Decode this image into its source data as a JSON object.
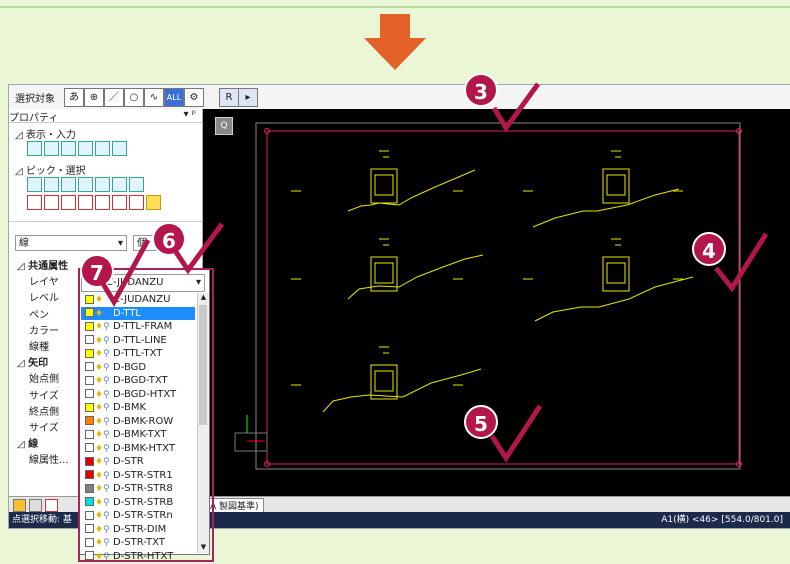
{
  "toolbar": {
    "select_label": "選択対象",
    "buttons": [
      "あ",
      "⊕",
      "／",
      "○",
      "∿",
      "ALL",
      "⚙"
    ],
    "r_button": "R",
    "arrow_button": "▸"
  },
  "panel": {
    "title": "プロパティ",
    "section_display": "表示・入力",
    "section_pick": "ピック・選択",
    "dropdown_line": "線",
    "dropdown_right": "個",
    "props": [
      {
        "label": "共通属性",
        "bold": true
      },
      {
        "label": "レイヤ",
        "bold": false
      },
      {
        "label": "レベル",
        "bold": false
      },
      {
        "label": "ペン",
        "bold": false
      },
      {
        "label": "カラー",
        "bold": false
      },
      {
        "label": "線種",
        "bold": false
      },
      {
        "label": "矢印",
        "bold": true
      },
      {
        "label": "始点側",
        "bold": false
      },
      {
        "label": "サイズ",
        "bold": false
      },
      {
        "label": "終点側",
        "bold": false
      },
      {
        "label": "サイズ",
        "bold": false
      },
      {
        "label": "線",
        "bold": true
      },
      {
        "label": "線属性...",
        "bold": false
      }
    ]
  },
  "layer_dropdown": {
    "current": "C-JUDANZU",
    "items": [
      {
        "name": "C-JUDANZU",
        "color": "#ffff00",
        "selected": false,
        "mag": false
      },
      {
        "name": "D-TTL",
        "color": "#ffff00",
        "selected": true,
        "mag": false
      },
      {
        "name": "D-TTL-FRAM",
        "color": "#ffff00",
        "selected": false,
        "mag": true
      },
      {
        "name": "D-TTL-LINE",
        "color": "#ffffff",
        "selected": false,
        "mag": true
      },
      {
        "name": "D-TTL-TXT",
        "color": "#ffff00",
        "selected": false,
        "mag": true
      },
      {
        "name": "D-BGD",
        "color": "#ffffff",
        "selected": false,
        "mag": true
      },
      {
        "name": "D-BGD-TXT",
        "color": "#ffffff",
        "selected": false,
        "mag": true
      },
      {
        "name": "D-BGD-HTXT",
        "color": "#ffffff",
        "selected": false,
        "mag": true
      },
      {
        "name": "D-BMK",
        "color": "#ffff00",
        "selected": false,
        "mag": true
      },
      {
        "name": "D-BMK-ROW",
        "color": "#ff8000",
        "selected": false,
        "mag": true
      },
      {
        "name": "D-BMK-TXT",
        "color": "#ffffff",
        "selected": false,
        "mag": true
      },
      {
        "name": "D-BMK-HTXT",
        "color": "#ffffff",
        "selected": false,
        "mag": true
      },
      {
        "name": "D-STR",
        "color": "#e00000",
        "selected": false,
        "mag": true
      },
      {
        "name": "D-STR-STR1",
        "color": "#e00000",
        "selected": false,
        "mag": true
      },
      {
        "name": "D-STR-STR8",
        "color": "#808080",
        "selected": false,
        "mag": true
      },
      {
        "name": "D-STR-STRB",
        "color": "#00e0e0",
        "selected": false,
        "mag": true
      },
      {
        "name": "D-STR-STRn",
        "color": "#ffffff",
        "selected": false,
        "mag": true
      },
      {
        "name": "D-STR-DIM",
        "color": "#ffffff",
        "selected": false,
        "mag": true
      },
      {
        "name": "D-STR-TXT",
        "color": "#ffffff",
        "selected": false,
        "mag": true
      },
      {
        "name": "D-STR-HTXT",
        "color": "#ffffff",
        "selected": false,
        "mag": true
      }
    ]
  },
  "canvas": {
    "tab_label": "A 製図基準)",
    "status_left": "点選択移動: 基",
    "status_right": "A1(横) <46> [554.0/801.0]"
  },
  "badges": {
    "b3": "3",
    "b4": "4",
    "b5": "5",
    "b6": "6",
    "b7": "7"
  },
  "colors": {
    "accent": "#b2164b",
    "arrow": "#e2622a"
  }
}
